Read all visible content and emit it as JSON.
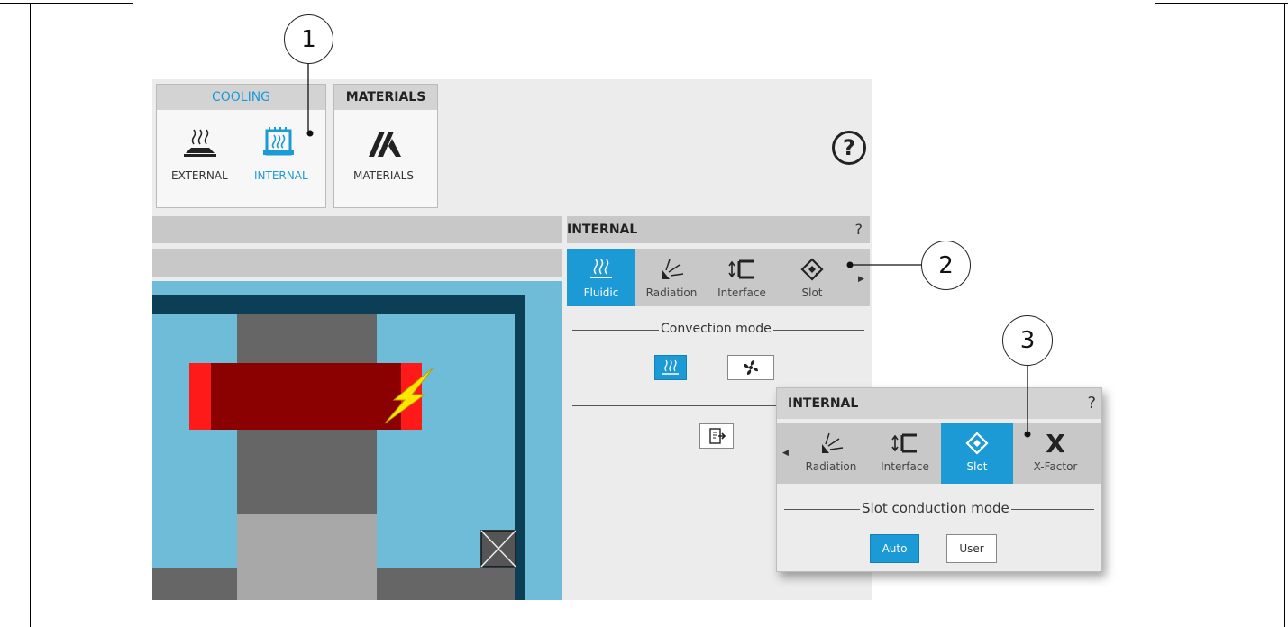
{
  "ribbon": {
    "cooling_tab": "COOLING",
    "materials_tab": "MATERIALS",
    "external_label": "EXTERNAL",
    "internal_label": "INTERNAL",
    "materials_label": "MATERIALS",
    "help_glyph": "?"
  },
  "internal_panel": {
    "title": "INTERNAL",
    "help_glyph": "?",
    "tools": [
      {
        "label": "Fluidic",
        "icon": "fluidic-icon",
        "active": true
      },
      {
        "label": "Radiation",
        "icon": "radiation-icon",
        "active": false
      },
      {
        "label": "Interface",
        "icon": "interface-icon",
        "active": false
      },
      {
        "label": "Slot",
        "icon": "slot-icon",
        "active": false
      }
    ],
    "section": "Convection mode"
  },
  "popup_panel": {
    "title": "INTERNAL",
    "help_glyph": "?",
    "tools": [
      {
        "label": "Radiation",
        "icon": "radiation-icon",
        "active": false
      },
      {
        "label": "Interface",
        "icon": "interface-icon",
        "active": false
      },
      {
        "label": "Slot",
        "icon": "slot-icon",
        "active": true
      },
      {
        "label": "X-Factor",
        "icon": "x-factor-icon",
        "active": false
      }
    ],
    "section": "Slot conduction mode",
    "auto_label": "Auto",
    "user_label": "User"
  },
  "callouts": [
    "1",
    "2",
    "3"
  ],
  "colors": {
    "accent": "#1b9ad6",
    "ribbon_bg": "#ececec",
    "cavity": "#6fbcd8",
    "frame": "#0c3f55",
    "winding": "#8b0000",
    "winding_end": "#ff1a1a",
    "lightning": "#ffe600"
  }
}
